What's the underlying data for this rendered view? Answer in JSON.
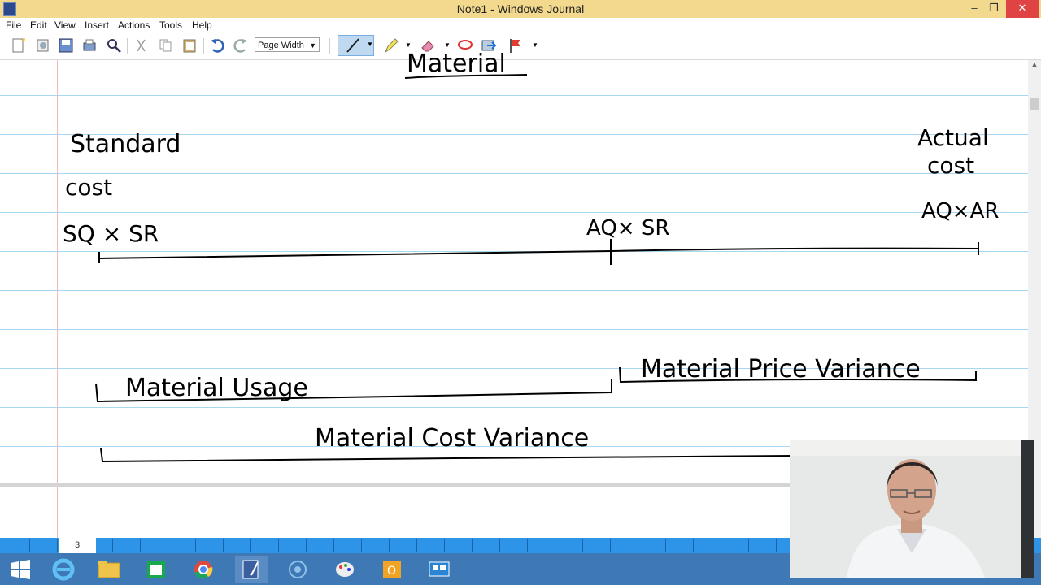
{
  "window": {
    "title": "Note1 - Windows Journal",
    "minimize": "–",
    "maximize": "❐",
    "close": "✕"
  },
  "menu": [
    "File",
    "Edit",
    "View",
    "Insert",
    "Actions",
    "Tools",
    "Help"
  ],
  "toolbar": {
    "zoom": "Page Width",
    "active_tool": "pen"
  },
  "page": {
    "number": "3"
  },
  "ink": {
    "heading": "Material",
    "left_label_1": "Standard",
    "left_label_2": "cost",
    "left_formula": "SQ × SR",
    "mid_formula": "AQ× SR",
    "right_label_1": "Actual",
    "right_label_2": "cost",
    "right_formula": "AQ×AR",
    "usage_label": "Material   Usage",
    "price_label": "Material  Price  Variance",
    "cost_label": "Material   Cost   Variance"
  },
  "colors": {
    "titlebar": "#f3d98d",
    "taskbar": "#3f79b5",
    "pagebar": "#2d94e8",
    "rule": "#a9d6f0",
    "margin": "#f0b7b7"
  }
}
